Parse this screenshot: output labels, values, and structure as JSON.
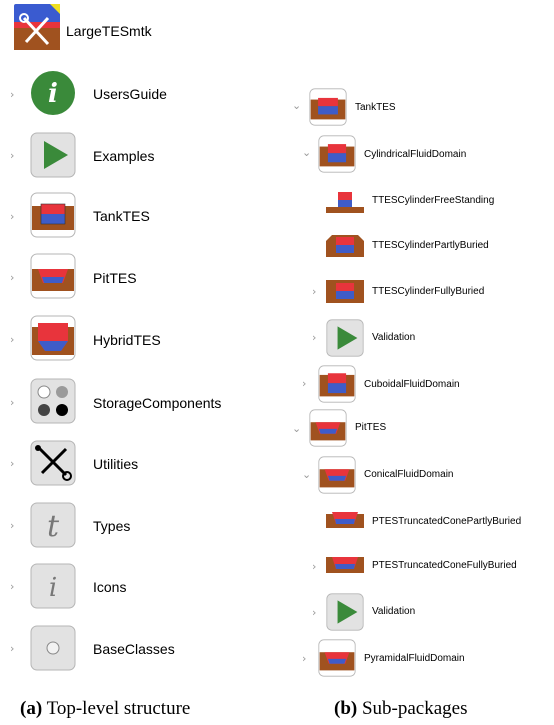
{
  "left_panel": {
    "root": {
      "label": "LargeTESmtk",
      "icon": "library-tools-icon"
    },
    "items": [
      {
        "label": "UsersGuide",
        "icon": "info-circle-icon"
      },
      {
        "label": "Examples",
        "icon": "play-icon"
      },
      {
        "label": "TankTES",
        "icon": "tank-icon"
      },
      {
        "label": "PitTES",
        "icon": "pit-icon"
      },
      {
        "label": "HybridTES",
        "icon": "hybrid-icon"
      },
      {
        "label": "StorageComponents",
        "icon": "components-icon"
      },
      {
        "label": "Utilities",
        "icon": "wrench-screwdriver-icon"
      },
      {
        "label": "Types",
        "icon": "type-t-icon"
      },
      {
        "label": "Icons",
        "icon": "icons-i-icon"
      },
      {
        "label": "BaseClasses",
        "icon": "base-circle-icon"
      }
    ]
  },
  "right_panel": {
    "items": [
      {
        "label": "TankTES"
      },
      {
        "label": "CylindricalFluidDomain"
      },
      {
        "label": "TTESCylinderFreeStanding"
      },
      {
        "label": "TTESCylinderPartlyBuried"
      },
      {
        "label": "TTESCylinderFullyBuried"
      },
      {
        "label": "Validation"
      },
      {
        "label": "CuboidalFluidDomain"
      },
      {
        "label": "PitTES"
      },
      {
        "label": "ConicalFluidDomain"
      },
      {
        "label": "PTESTruncatedConePartlyBuried"
      },
      {
        "label": "PTESTruncatedConeFullyBuried"
      },
      {
        "label": "Validation"
      },
      {
        "label": "PyramidalFluidDomain"
      }
    ]
  },
  "captions": {
    "a_tag": "(a)",
    "a_text": "Top-level structure",
    "b_tag": "(b)",
    "b_text": "Sub-packages"
  },
  "colors": {
    "soil": "#a0521f",
    "water_red": "#e8343c",
    "water_blue": "#3f5cc8",
    "green": "#3a8a3a",
    "icon_gray": "#e2e2e2"
  }
}
